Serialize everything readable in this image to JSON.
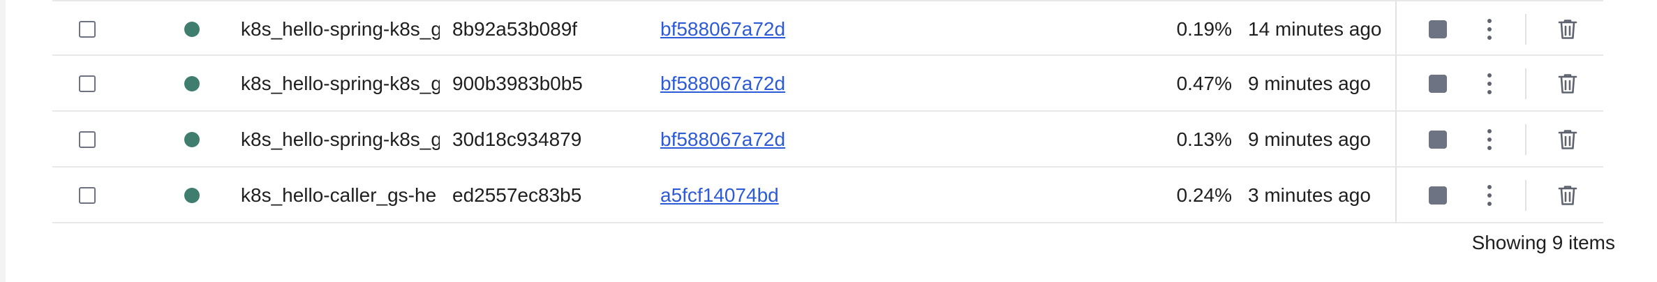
{
  "colors": {
    "status_running": "#3f7d6e",
    "stop_button": "#6d7382",
    "link": "#2d5bd7"
  },
  "icons": {
    "status": "status-dot-icon",
    "stop": "stop-square-icon",
    "more": "more-vertical-icon",
    "delete": "trash-icon"
  },
  "rows": [
    {
      "name": "k8s_hello-spring-k8s_g",
      "id": "8b92a53b089f",
      "image": "bf588067a72d",
      "cpu": "0.19%",
      "started": "14 minutes ago"
    },
    {
      "name": "k8s_hello-spring-k8s_g",
      "id": "900b3983b0b5",
      "image": "bf588067a72d",
      "cpu": "0.47%",
      "started": "9 minutes ago"
    },
    {
      "name": "k8s_hello-spring-k8s_g",
      "id": "30d18c934879",
      "image": "bf588067a72d",
      "cpu": "0.13%",
      "started": "9 minutes ago"
    },
    {
      "name": "k8s_hello-caller_gs-he",
      "id": "ed2557ec83b5",
      "image": "a5fcf14074bd",
      "cpu": "0.24%",
      "started": "3 minutes ago"
    }
  ],
  "footer": {
    "summary": "Showing 9 items"
  }
}
